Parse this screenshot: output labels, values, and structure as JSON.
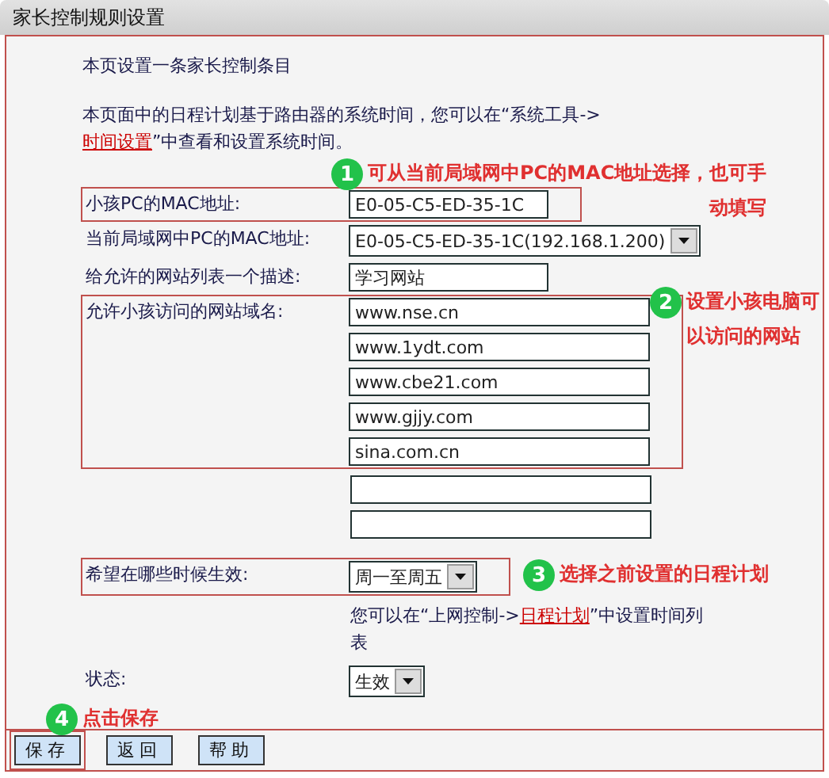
{
  "title": "家长控制规则设置",
  "intro": "本页设置一条家长控制条目",
  "note": {
    "before": "本页面中的日程计划基于路由器的系统时间，您可以在“系统工具->",
    "link": "时间设置",
    "after": "”中查看和设置系统时间。"
  },
  "fields": [
    {
      "kind": "text",
      "label": "小孩PC的MAC地址:",
      "value": "E0-05-C5-ED-35-1C",
      "highlighted": true
    },
    {
      "kind": "select",
      "label": "当前局域网中PC的MAC地址:",
      "value": "E0-05-C5-ED-35-1C(192.168.1.200)",
      "highlighted": false
    },
    {
      "kind": "text",
      "label": "给允许的网站列表一个描述:",
      "value": "学习网站",
      "highlighted": false
    },
    {
      "kind": "list",
      "label": "允许小孩访问的网站域名:",
      "values": [
        "www.nse.cn",
        "www.1ydt.com",
        "www.cbe21.com",
        "www.gjjy.com",
        "sina.com.cn"
      ],
      "highlighted": true
    },
    {
      "kind": "select",
      "label": "希望在哪些时候生效:",
      "value": "周一至周五",
      "highlighted": true,
      "hint": {
        "before": "您可以在“上网控制->",
        "link": "日程计划",
        "after": "”中设置时间列表"
      }
    },
    {
      "kind": "select",
      "label": "状态:",
      "value": "生效",
      "highlighted": false
    }
  ],
  "callouts": [
    {
      "number": "1",
      "lines": [
        "可从当前局域网中PC的MAC地址选择，也可手",
        "动填写"
      ]
    },
    {
      "number": "2",
      "lines": [
        "设置小孩电脑可",
        "以访问的网站"
      ]
    },
    {
      "number": "3",
      "lines": [
        "选择之前设置的日程计划"
      ]
    },
    {
      "number": "4",
      "lines": [
        "点击保存"
      ]
    }
  ],
  "buttons": [
    {
      "label": "保存",
      "highlighted": true
    },
    {
      "label": "返回",
      "highlighted": false
    },
    {
      "label": "帮助",
      "highlighted": false
    }
  ]
}
